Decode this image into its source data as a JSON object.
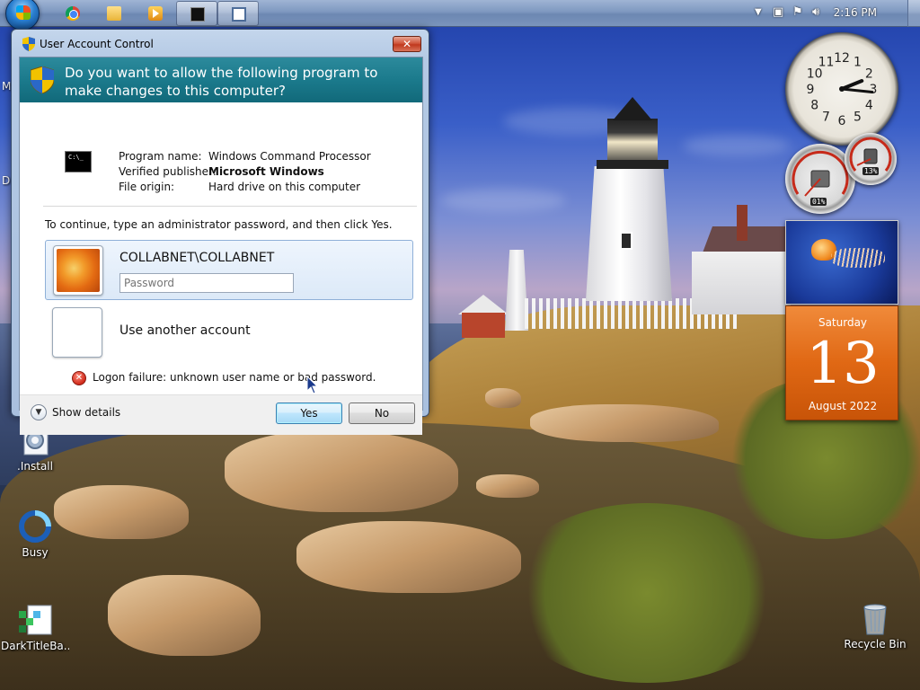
{
  "taskbar": {
    "clock": "2:16 PM",
    "apps": [
      {
        "name": "Google Chrome",
        "icon": "chrome-icon"
      },
      {
        "name": "Windows Explorer",
        "icon": "folder-icon"
      },
      {
        "name": "Windows Media Player",
        "icon": "media-player-icon"
      },
      {
        "name": "Command Prompt",
        "icon": "cmd-icon",
        "active": true
      },
      {
        "name": "Window",
        "icon": "window-icon",
        "active": true
      }
    ],
    "tray_icons": [
      "show-hidden-icons-chevron",
      "network-icon",
      "action-center-flag-icon",
      "volume-icon"
    ]
  },
  "uac": {
    "title": "User Account Control",
    "close_label": "✕",
    "question": "Do you want to allow the following program to make changes to this computer?",
    "program_name_label": "Program name:",
    "program_name": "Windows Command Processor",
    "publisher_label": "Verified publisher:",
    "publisher": "Microsoft Windows",
    "origin_label": "File origin:",
    "origin": "Hard drive on this computer",
    "program_icon_text": "C:\\_",
    "instruction": "To continue, type an administrator password, and then click Yes.",
    "account_name": "COLLABNET\\COLLABNET",
    "password_placeholder": "Password",
    "password_value": "",
    "another_account": "Use another account",
    "error": "Logon failure: unknown user name or bad password.",
    "show_details": "Show details",
    "yes_label": "Yes",
    "no_label": "No"
  },
  "desktop_icons": [
    {
      "label": ".Install",
      "icon": "installer-gear-icon"
    },
    {
      "label": "Busy",
      "icon": "busy-cursor-icon"
    },
    {
      "label": "DarkTitleBa...",
      "icon": "app-package-icon"
    },
    {
      "label": "Recycle Bin",
      "icon": "recycle-bin-icon"
    }
  ],
  "edge_letters": [
    "M",
    "D"
  ],
  "gadgets": {
    "clock": {
      "hour": 2,
      "minute": 16
    },
    "cpu_meter": {
      "cpu": "01%",
      "memory": "13%"
    },
    "calendar": {
      "weekday": "Saturday",
      "day": "13",
      "month_year": "August 2022"
    }
  },
  "colors": {
    "uac_header": "#1b7a8c",
    "calendar_orange": "#e06814",
    "close_red": "#c0391e"
  }
}
